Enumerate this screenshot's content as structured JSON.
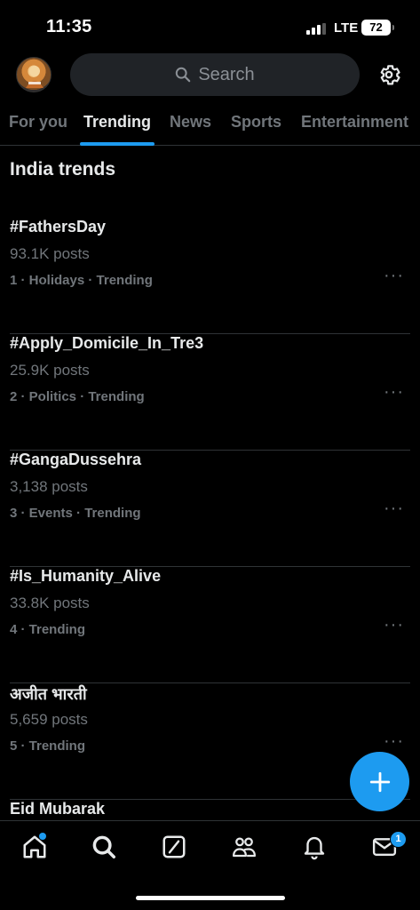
{
  "status_bar": {
    "time": "11:35",
    "network": "LTE",
    "battery": "72"
  },
  "header": {
    "search_placeholder": "Search"
  },
  "tabs": [
    {
      "label": "For you"
    },
    {
      "label": "Trending"
    },
    {
      "label": "News"
    },
    {
      "label": "Sports"
    },
    {
      "label": "Entertainment"
    }
  ],
  "active_tab": "Trending",
  "section_title": "India trends",
  "trends": [
    {
      "name": "#FathersDay",
      "posts": "93.1K posts",
      "meta": "1 · Holidays · Trending"
    },
    {
      "name": "#Apply_Domicile_In_Tre3",
      "posts": "25.9K posts",
      "meta": "2 · Politics · Trending"
    },
    {
      "name": "#GangaDussehra",
      "posts": "3,138 posts",
      "meta": "3 · Events · Trending"
    },
    {
      "name": "#Is_Humanity_Alive",
      "posts": "33.8K posts",
      "meta": "4 · Trending"
    },
    {
      "name": "अजीत भारती",
      "posts": "5,659 posts",
      "meta": "5 · Trending"
    },
    {
      "name": "Eid Mubarak",
      "posts": "",
      "meta": ""
    }
  ],
  "more_glyph": "···",
  "bottom_nav": {
    "items": [
      "home-icon",
      "search-icon",
      "grok-icon",
      "communities-icon",
      "notifications-icon",
      "messages-icon"
    ],
    "messages_badge": "1"
  },
  "colors": {
    "accent": "#1d9bf0",
    "background": "#000000",
    "muted": "#71767b",
    "text": "#e7e9ea"
  }
}
